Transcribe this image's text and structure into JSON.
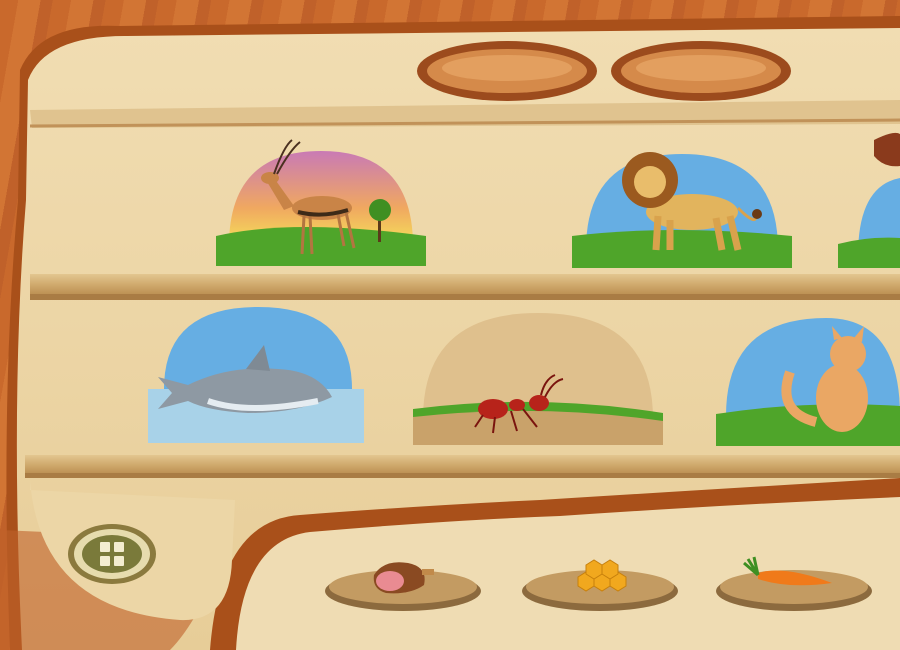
{
  "top_buttons": [
    {
      "id": "left",
      "label": ""
    },
    {
      "id": "right",
      "label": ""
    }
  ],
  "shelves": [
    {
      "row": "top",
      "animals": [
        "gazelle",
        "lion",
        "horse"
      ]
    },
    {
      "row": "bottom",
      "animals": [
        "shark",
        "ant",
        "cat"
      ]
    }
  ],
  "food_plates": [
    {
      "name": "meat",
      "label": ""
    },
    {
      "name": "honey",
      "label": ""
    },
    {
      "name": "carrot",
      "label": ""
    }
  ],
  "menu_button": {
    "icon": "grid-icon"
  },
  "colors": {
    "wood_dark": "#b2561f",
    "panel": "#ecd4a4",
    "shelf_edge": "#d7b47c",
    "grass": "#4fa52a",
    "sky": "#66aee3",
    "sunset": "#f2d350"
  }
}
